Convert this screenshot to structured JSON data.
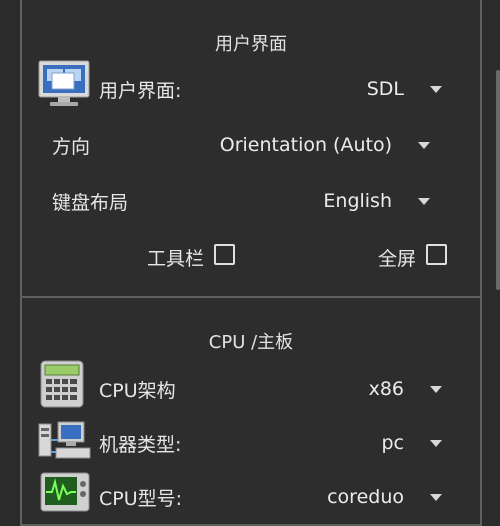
{
  "ui_section": {
    "title": "用户界面",
    "user_interface_label": "用户界面:",
    "user_interface_value": "SDL",
    "orientation_label": "方向",
    "orientation_value": "Orientation (Auto)",
    "keyboard_label": "键盘布局",
    "keyboard_value": "English",
    "toolbar_label": "工具栏",
    "fullscreen_label": "全屏"
  },
  "cpu_section": {
    "title": "CPU /主板",
    "arch_label": "CPU架构",
    "arch_value": "x86",
    "machine_label": "机器类型:",
    "machine_value": "pc",
    "model_label": "CPU型号:",
    "model_value": "coreduo"
  },
  "icons": [
    "monitor-icon",
    "calculator-icon",
    "network-computers-icon",
    "oscilloscope-icon",
    "chevron-down-icon"
  ],
  "colors": {
    "background": "#2b2b2b",
    "panel_border": "#5f5f5f",
    "text": "#e6e6e6"
  }
}
